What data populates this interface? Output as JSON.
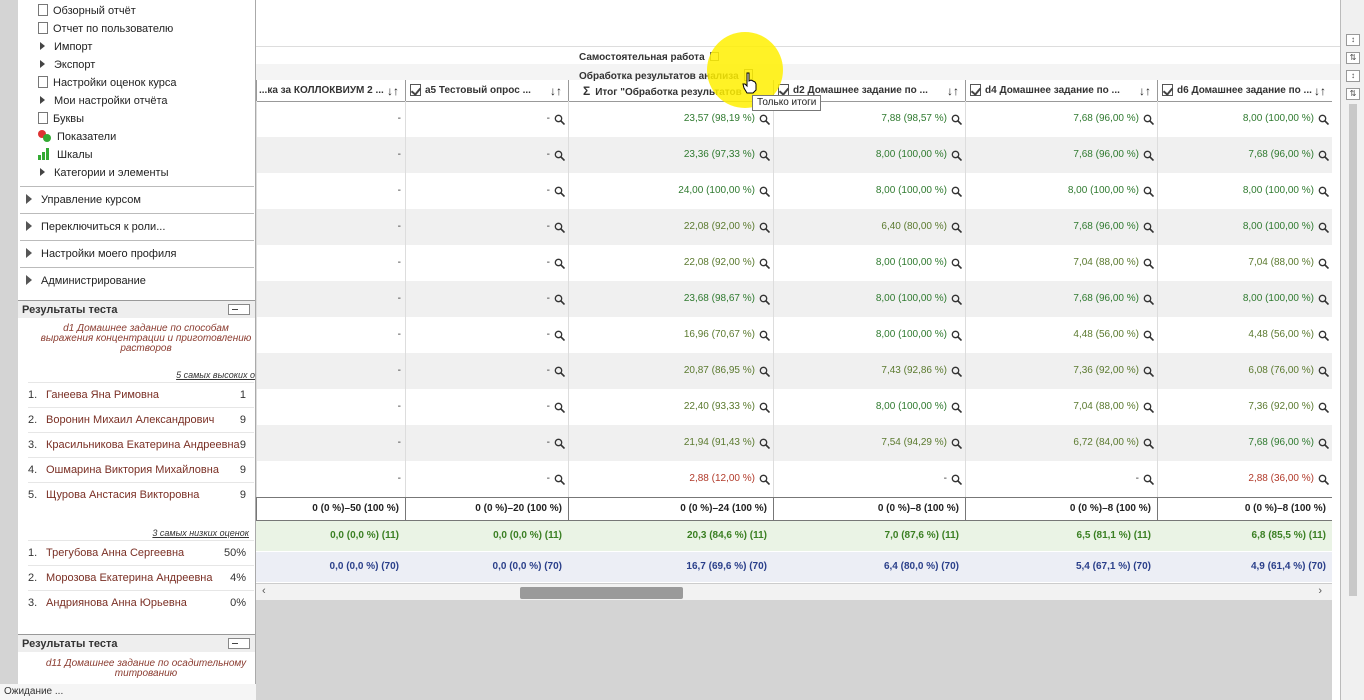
{
  "sidebar": {
    "nav_items": [
      {
        "label": "Обзорный отчёт",
        "icon": "report-icon"
      },
      {
        "label": "Отчет по пользователю",
        "icon": "report-icon"
      },
      {
        "label": "Импорт",
        "icon": "expand-arrow"
      },
      {
        "label": "Экспорт",
        "icon": "expand-arrow"
      },
      {
        "label": "Настройки оценок курса",
        "icon": "settings-doc-icon"
      },
      {
        "label": "Мои настройки отчёта",
        "icon": "expand-arrow"
      },
      {
        "label": "Буквы",
        "icon": "letters-icon"
      },
      {
        "label": "Показатели",
        "icon": "outcomes-icon"
      },
      {
        "label": "Шкалы",
        "icon": "scales-icon"
      },
      {
        "label": "Категории и элементы",
        "icon": "expand-arrow"
      }
    ],
    "sections": [
      "Управление курсом",
      "Переключиться к роли...",
      "Настройки моего профиля",
      "Администрирование"
    ],
    "quiz_block_1": {
      "title": "Результаты теста",
      "quiz_name": "d1 Домашнее задание по способам выражения концентрации и приготовлению растворов",
      "top_link": "5 самых высоких о",
      "top": [
        {
          "n": "1.",
          "name": "Ганеева Яна Римовна",
          "score": "1"
        },
        {
          "n": "2.",
          "name": "Воронин Михаил Александрович",
          "score": "9"
        },
        {
          "n": "3.",
          "name": "Красильникова Екатерина Андреевна",
          "score": "9"
        },
        {
          "n": "4.",
          "name": "Ошмарина Виктория Михайловна",
          "score": "9"
        },
        {
          "n": "5.",
          "name": "Щурова Анстасия Викторовна",
          "score": "9"
        }
      ],
      "low_link": "3 самых низких оценок",
      "low": [
        {
          "n": "1.",
          "name": "Трегубова Анна Сергеевна",
          "score": "50%"
        },
        {
          "n": "2.",
          "name": "Морозова Екатерина Андреевна",
          "score": "4%"
        },
        {
          "n": "3.",
          "name": "Андриянова Анна Юрьевна",
          "score": "0%"
        }
      ]
    },
    "quiz_block_2": {
      "title": "Результаты теста",
      "quiz_name": "d11 Домашнее задание по осадительному титрованию"
    }
  },
  "statusbar": "Ожидание ...",
  "grader": {
    "category_title": "Самостоятельная работа",
    "subcategory_title": "Обработка результатов анализа",
    "tooltip": "Только итоги",
    "columns": [
      {
        "label": "...ка за КОЛЛОКВИУМ 2 ...",
        "type": "item"
      },
      {
        "label": "a5 Тестовый опрос ...",
        "type": "quiz"
      },
      {
        "label": "Итог \"Обработка результатов",
        "type": "total"
      },
      {
        "label": "d2 Домашнее задание по ...",
        "type": "quiz"
      },
      {
        "label": "d4 Домашнее задание по ...",
        "type": "quiz"
      },
      {
        "label": "d6 Домашнее задание по ...",
        "type": "quiz"
      }
    ],
    "rows": [
      [
        "-",
        "-",
        "23,57 (98,19 %)",
        "7,88 (98,57 %)",
        "7,68 (96,00 %)",
        "8,00 (100,00 %)"
      ],
      [
        "-",
        "-",
        "23,36 (97,33 %)",
        "8,00 (100,00 %)",
        "7,68 (96,00 %)",
        "7,68 (96,00 %)"
      ],
      [
        "-",
        "-",
        "24,00 (100,00 %)",
        "8,00 (100,00 %)",
        "8,00 (100,00 %)",
        "8,00 (100,00 %)"
      ],
      [
        "-",
        "-",
        "22,08 (92,00 %)",
        "6,40 (80,00 %)",
        "7,68 (96,00 %)",
        "8,00 (100,00 %)"
      ],
      [
        "-",
        "-",
        "22,08 (92,00 %)",
        "8,00 (100,00 %)",
        "7,04 (88,00 %)",
        "7,04 (88,00 %)"
      ],
      [
        "-",
        "-",
        "23,68 (98,67 %)",
        "8,00 (100,00 %)",
        "7,68 (96,00 %)",
        "8,00 (100,00 %)"
      ],
      [
        "-",
        "-",
        "16,96 (70,67 %)",
        "8,00 (100,00 %)",
        "4,48 (56,00 %)",
        "4,48 (56,00 %)"
      ],
      [
        "-",
        "-",
        "20,87 (86,95 %)",
        "7,43 (92,86 %)",
        "7,36 (92,00 %)",
        "6,08 (76,00 %)"
      ],
      [
        "-",
        "-",
        "22,40 (93,33 %)",
        "8,00 (100,00 %)",
        "7,04 (88,00 %)",
        "7,36 (92,00 %)"
      ],
      [
        "-",
        "-",
        "21,94 (91,43 %)",
        "7,54 (94,29 %)",
        "6,72 (84,00 %)",
        "7,68 (96,00 %)"
      ],
      [
        "-",
        "-",
        "2,88 (12,00 %)",
        "-",
        "-",
        "2,88 (36,00 %)"
      ]
    ],
    "range_row": [
      "0 (0 %)–50 (100 %)",
      "0 (0 %)–20 (100 %)",
      "0 (0 %)–24 (100 %)",
      "0 (0 %)–8 (100 %)",
      "0 (0 %)–8 (100 %)",
      "0 (0 %)–8 (100 %)"
    ],
    "avg_row_1": [
      "0,0 (0,0 %) (11)",
      "0,0 (0,0 %) (11)",
      "20,3 (84,6 %) (11)",
      "7,0 (87,6 %) (11)",
      "6,5 (81,1 %) (11)",
      "6,8 (85,5 %) (11)"
    ],
    "avg_row_2": [
      "0,0 (0,0 %) (70)",
      "0,0 (0,0 %) (70)",
      "16,7 (69,6 %) (70)",
      "6,4 (80,0 %) (70)",
      "5,4 (67,1 %) (70)",
      "4,9 (61,4 %) (70)"
    ]
  },
  "colors": {
    "highlight": "#ffeb00",
    "avg_green": "#3a7f22",
    "avg_blue": "#2a3f8a",
    "low_grade": "#b13a2a"
  }
}
